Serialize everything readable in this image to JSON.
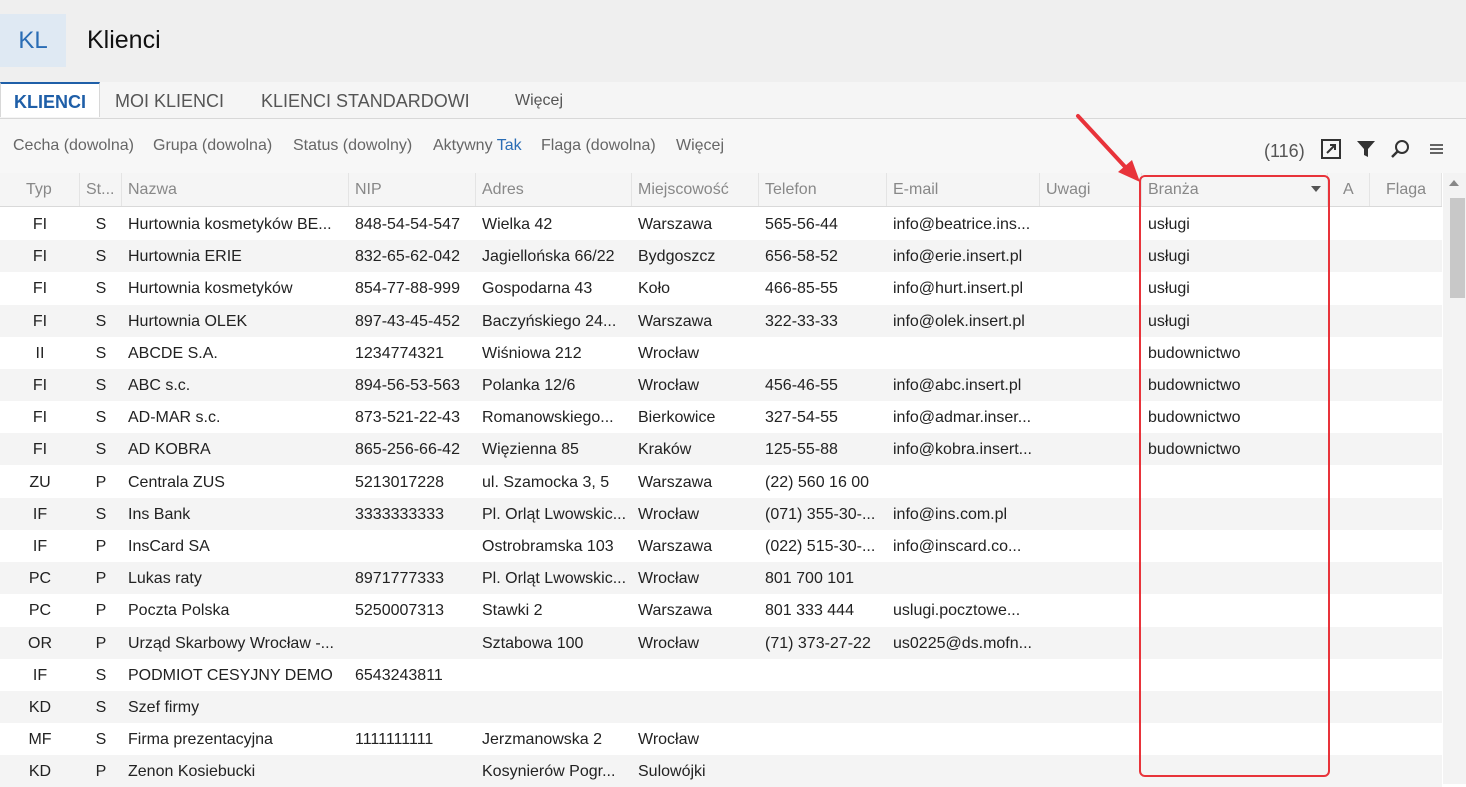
{
  "app": {
    "badge": "KL",
    "title": "Klienci"
  },
  "tabs": [
    "KLIENCI",
    "MOI KLIENCI",
    "KLIENCI STANDARDOWI",
    "Więcej"
  ],
  "filters": [
    {
      "label": "Cecha (dowolna)",
      "value": ""
    },
    {
      "label": "Grupa (dowolna)",
      "value": ""
    },
    {
      "label": "Status (dowolny)",
      "value": ""
    },
    {
      "label": "Aktywny ",
      "value": "Tak"
    },
    {
      "label": "Flaga (dowolna)",
      "value": ""
    },
    {
      "label": "Więcej",
      "value": ""
    }
  ],
  "toolbar": {
    "count": "(116)",
    "icons": [
      "expand-icon",
      "filter-icon",
      "search-icon",
      "menu-icon"
    ]
  },
  "columns": [
    "Typ",
    "St...",
    "Nazwa",
    "NIP",
    "Adres",
    "Miejscowość",
    "Telefon",
    "E-mail",
    "Uwagi",
    "Branża",
    "A",
    "Flaga"
  ],
  "rows": [
    [
      "FI",
      "S",
      "Hurtownia kosmetyków BE...",
      "848-54-54-547",
      "Wielka  42",
      "Warszawa",
      "565-56-44",
      "info@beatrice.ins...",
      "",
      "usługi",
      "",
      ""
    ],
    [
      "FI",
      "S",
      "Hurtownia ERIE",
      "832-65-62-042",
      "Jagiellońska  66/22",
      "Bydgoszcz",
      "656-58-52",
      "info@erie.insert.pl",
      "",
      "usługi",
      "",
      ""
    ],
    [
      "FI",
      "S",
      "Hurtownia kosmetyków",
      "854-77-88-999",
      "Gospodarna  43",
      "Koło",
      "466-85-55",
      "info@hurt.insert.pl",
      "",
      "usługi",
      "",
      ""
    ],
    [
      "FI",
      "S",
      "Hurtownia OLEK",
      "897-43-45-452",
      "Baczyńskiego  24...",
      "Warszawa",
      "322-33-33",
      "info@olek.insert.pl",
      "",
      "usługi",
      "",
      ""
    ],
    [
      "II",
      "S",
      "ABCDE S.A.",
      "1234774321",
      "Wiśniowa 212",
      "Wrocław",
      "",
      "",
      "",
      "budownictwo",
      "",
      ""
    ],
    [
      "FI",
      "S",
      "ABC s.c.",
      "894-56-53-563",
      "Polanka  12/6",
      "Wrocław",
      "456-46-55",
      "info@abc.insert.pl",
      "",
      "budownictwo",
      "",
      ""
    ],
    [
      "FI",
      "S",
      "AD-MAR s.c.",
      "873-521-22-43",
      "Romanowskiego...",
      "Bierkowice",
      "327-54-55",
      "info@admar.inser...",
      "",
      "budownictwo",
      "",
      ""
    ],
    [
      "FI",
      "S",
      "AD KOBRA",
      "865-256-66-42",
      "Więzienna  85",
      "Kraków",
      "125-55-88",
      "info@kobra.insert...",
      "",
      "budownictwo",
      "",
      ""
    ],
    [
      "ZU",
      "P",
      "Centrala ZUS",
      "5213017228",
      "ul. Szamocka 3, 5",
      "Warszawa",
      "(22) 560 16 00",
      "",
      "",
      "",
      "",
      ""
    ],
    [
      "IF",
      "S",
      "Ins Bank",
      "3333333333",
      "Pl. Orląt Lwowskic...",
      "Wrocław",
      "(071) 355-30-...",
      "info@ins.com.pl",
      "",
      "",
      "",
      ""
    ],
    [
      "IF",
      "P",
      "InsCard SA",
      "",
      "Ostrobramska 103",
      "Warszawa",
      "(022) 515-30-...",
      "info@inscard.co...",
      "",
      "",
      "",
      ""
    ],
    [
      "PC",
      "P",
      "Lukas raty",
      "8971777333",
      "Pl. Orląt Lwowskic...",
      "Wrocław",
      "801 700 101",
      "",
      "",
      "",
      "",
      ""
    ],
    [
      "PC",
      "P",
      "Poczta Polska",
      "5250007313",
      "Stawki 2",
      "Warszawa",
      "801 333 444",
      "uslugi.pocztowe...",
      "",
      "",
      "",
      ""
    ],
    [
      "OR",
      "P",
      "Urząd Skarbowy Wrocław -...",
      "",
      "Sztabowa 100",
      "Wrocław",
      "(71) 373-27-22",
      "us0225@ds.mofn...",
      "",
      "",
      "",
      ""
    ],
    [
      "IF",
      "S",
      "PODMIOT CESYJNY DEMO",
      "6543243811",
      "",
      "",
      "",
      "",
      "",
      "",
      "",
      ""
    ],
    [
      "KD",
      "S",
      "Szef firmy",
      "",
      "",
      "",
      "",
      "",
      "",
      "",
      "",
      ""
    ],
    [
      "MF",
      "S",
      "Firma prezentacyjna",
      "1111111111",
      "Jerzmanowska 2",
      "Wrocław",
      "",
      "",
      "",
      "",
      "",
      ""
    ],
    [
      "KD",
      "P",
      "Zenon Kosiebucki",
      "",
      "Kosynierów Pogr...",
      "Sulowójki",
      "",
      "",
      "",
      "",
      "",
      ""
    ]
  ],
  "accent": "#1f5fa8",
  "highlight_color": "#e8333a"
}
